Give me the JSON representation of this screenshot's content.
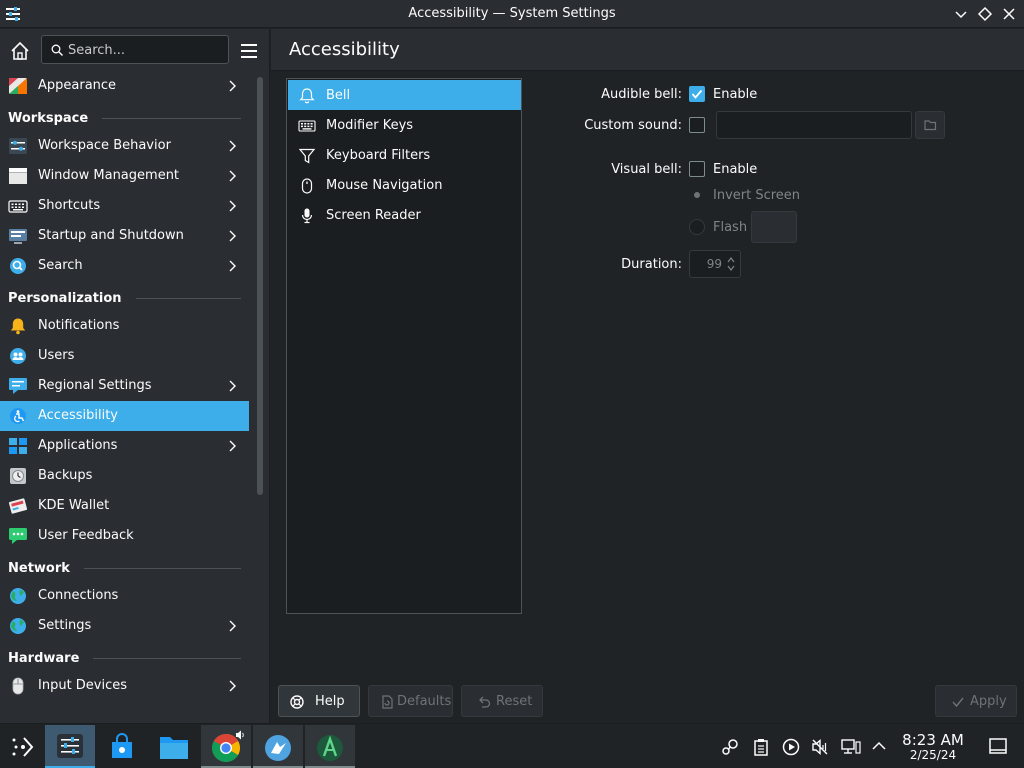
{
  "window": {
    "title": "Accessibility — System Settings"
  },
  "sidebar": {
    "search_placeholder": "Search...",
    "items": [
      {
        "type": "item",
        "label": "Appearance",
        "icon": "appearance-icon",
        "chevron": true
      },
      {
        "type": "category",
        "label": "Workspace"
      },
      {
        "type": "item",
        "label": "Workspace Behavior",
        "icon": "workspace-behavior-icon",
        "chevron": true
      },
      {
        "type": "item",
        "label": "Window Management",
        "icon": "window-management-icon",
        "chevron": true
      },
      {
        "type": "item",
        "label": "Shortcuts",
        "icon": "keyboard-icon",
        "chevron": true
      },
      {
        "type": "item",
        "label": "Startup and Shutdown",
        "icon": "startup-icon",
        "chevron": true
      },
      {
        "type": "item",
        "label": "Search",
        "icon": "search-icon",
        "chevron": true
      },
      {
        "type": "category",
        "label": "Personalization"
      },
      {
        "type": "item",
        "label": "Notifications",
        "icon": "bell-icon",
        "chevron": false
      },
      {
        "type": "item",
        "label": "Users",
        "icon": "users-icon",
        "chevron": false
      },
      {
        "type": "item",
        "label": "Regional Settings",
        "icon": "regional-icon",
        "chevron": true
      },
      {
        "type": "item",
        "label": "Accessibility",
        "icon": "accessibility-icon",
        "chevron": false,
        "active": true
      },
      {
        "type": "item",
        "label": "Applications",
        "icon": "applications-icon",
        "chevron": true
      },
      {
        "type": "item",
        "label": "Backups",
        "icon": "backups-icon",
        "chevron": false
      },
      {
        "type": "item",
        "label": "KDE Wallet",
        "icon": "wallet-icon",
        "chevron": false
      },
      {
        "type": "item",
        "label": "User Feedback",
        "icon": "feedback-icon",
        "chevron": false
      },
      {
        "type": "category",
        "label": "Network"
      },
      {
        "type": "item",
        "label": "Connections",
        "icon": "globe-icon",
        "chevron": false
      },
      {
        "type": "item",
        "label": "Settings",
        "icon": "globe-icon",
        "chevron": true
      },
      {
        "type": "category",
        "label": "Hardware"
      },
      {
        "type": "item",
        "label": "Input Devices",
        "icon": "mouse-icon",
        "chevron": true
      }
    ]
  },
  "main": {
    "title": "Accessibility",
    "subpages": [
      {
        "label": "Bell",
        "icon": "bell-icon",
        "active": true
      },
      {
        "label": "Modifier Keys",
        "icon": "keyboard-icon"
      },
      {
        "label": "Keyboard Filters",
        "icon": "filter-icon"
      },
      {
        "label": "Mouse Navigation",
        "icon": "mouse-icon"
      },
      {
        "label": "Screen Reader",
        "icon": "microphone-icon"
      }
    ],
    "form": {
      "audible_bell_label": "Audible bell:",
      "audible_bell_checkbox_text": "Enable",
      "audible_bell_checked": true,
      "custom_sound_label": "Custom sound:",
      "custom_sound_checked": false,
      "custom_sound_value": "",
      "visual_bell_label": "Visual bell:",
      "visual_bell_checkbox_text": "Enable",
      "visual_bell_checked": false,
      "invert_screen_text": "Invert Screen",
      "flash_text": "Flash",
      "duration_label": "Duration:",
      "duration_value": "99"
    }
  },
  "buttons": {
    "help": "Help",
    "defaults": "Defaults",
    "reset": "Reset",
    "apply": "Apply"
  },
  "taskbar": {
    "apps": [
      {
        "name": "application-launcher",
        "icon": "steam-deck-launcher-icon"
      },
      {
        "name": "system-settings",
        "icon": "settings-icon",
        "state": "active"
      },
      {
        "name": "discover",
        "icon": "store-icon"
      },
      {
        "name": "dolphin",
        "icon": "folder-icon"
      },
      {
        "name": "chrome",
        "icon": "chrome-icon",
        "state": "open"
      },
      {
        "name": "app-5",
        "icon": "bird-icon",
        "state": "open"
      },
      {
        "name": "app-6",
        "icon": "letter-a-icon",
        "state": "open"
      }
    ],
    "tray_icons": [
      "steam-icon",
      "clipboard-icon",
      "media-play-icon",
      "audio-muted-icon",
      "network-wired-icon",
      "chevron-up-icon"
    ],
    "clock": {
      "time": "8:23 AM",
      "date": "2/25/24"
    }
  },
  "colors": {
    "accent": "#3daee9",
    "window_bg": "#202326",
    "panel_bg": "#2a2e32",
    "view_bg": "#1b1e20",
    "text": "#fcfcfc"
  }
}
